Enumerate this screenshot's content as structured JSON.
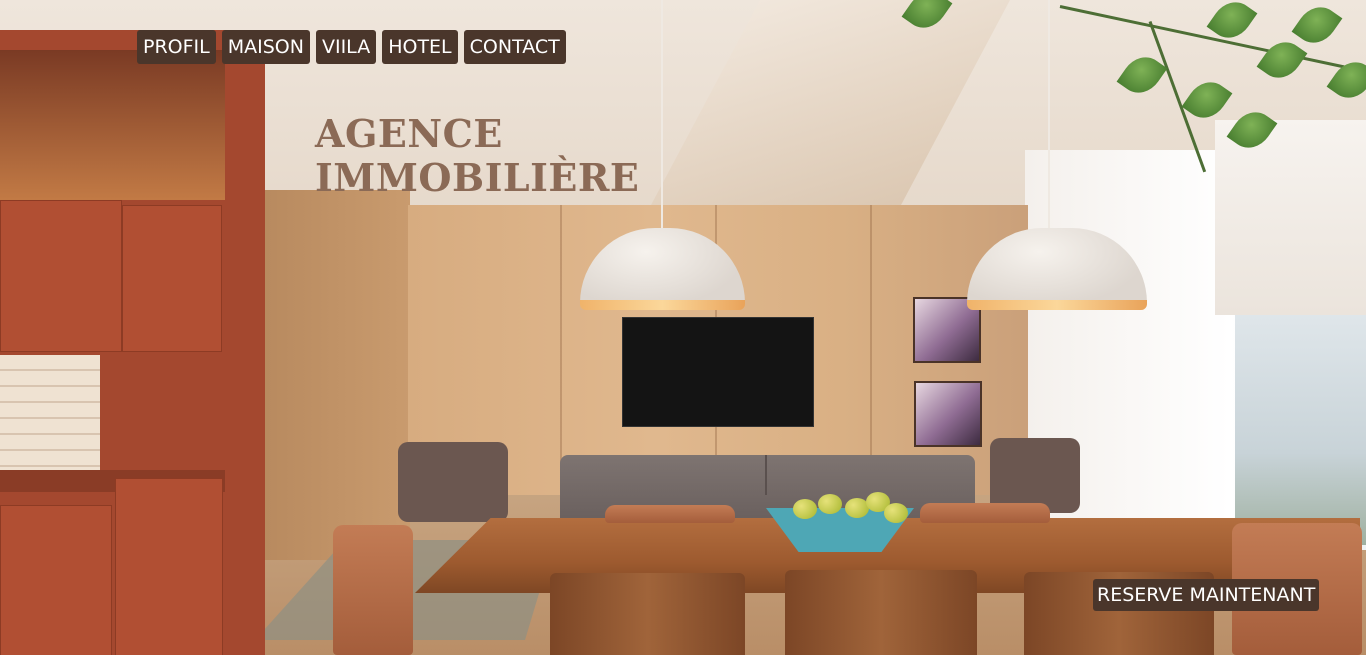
{
  "nav": {
    "items": [
      {
        "label": "PROFIL"
      },
      {
        "label": "MAISON"
      },
      {
        "label": "VIILA"
      },
      {
        "label": "HOTEL"
      },
      {
        "label": "CONTACT"
      }
    ]
  },
  "hero": {
    "title_line1": "AGENCE",
    "title_line2": "IMMOBILIÈRE",
    "cta_label": "RESERVE MAINTENANT"
  },
  "colors": {
    "button_bg": "#4a362b",
    "button_text": "#ffffff",
    "title_color": "#8b6a56"
  }
}
